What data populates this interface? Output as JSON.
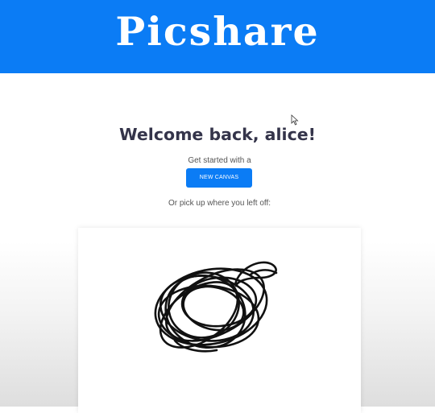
{
  "header": {
    "logo_text": "Picshare",
    "background_color": "#0b7cf5"
  },
  "main": {
    "welcome_text": "Welcome back, alice!",
    "get_started_text": "Get started with a",
    "new_canvas_label": "NEW CANVAS",
    "pick_up_text": "Or pick up where you left off:"
  },
  "recent_canvases": [
    {
      "thumbnail": "black scribble drawing"
    }
  ],
  "colors": {
    "accent": "#0b7cf5",
    "heading": "#34344a"
  }
}
